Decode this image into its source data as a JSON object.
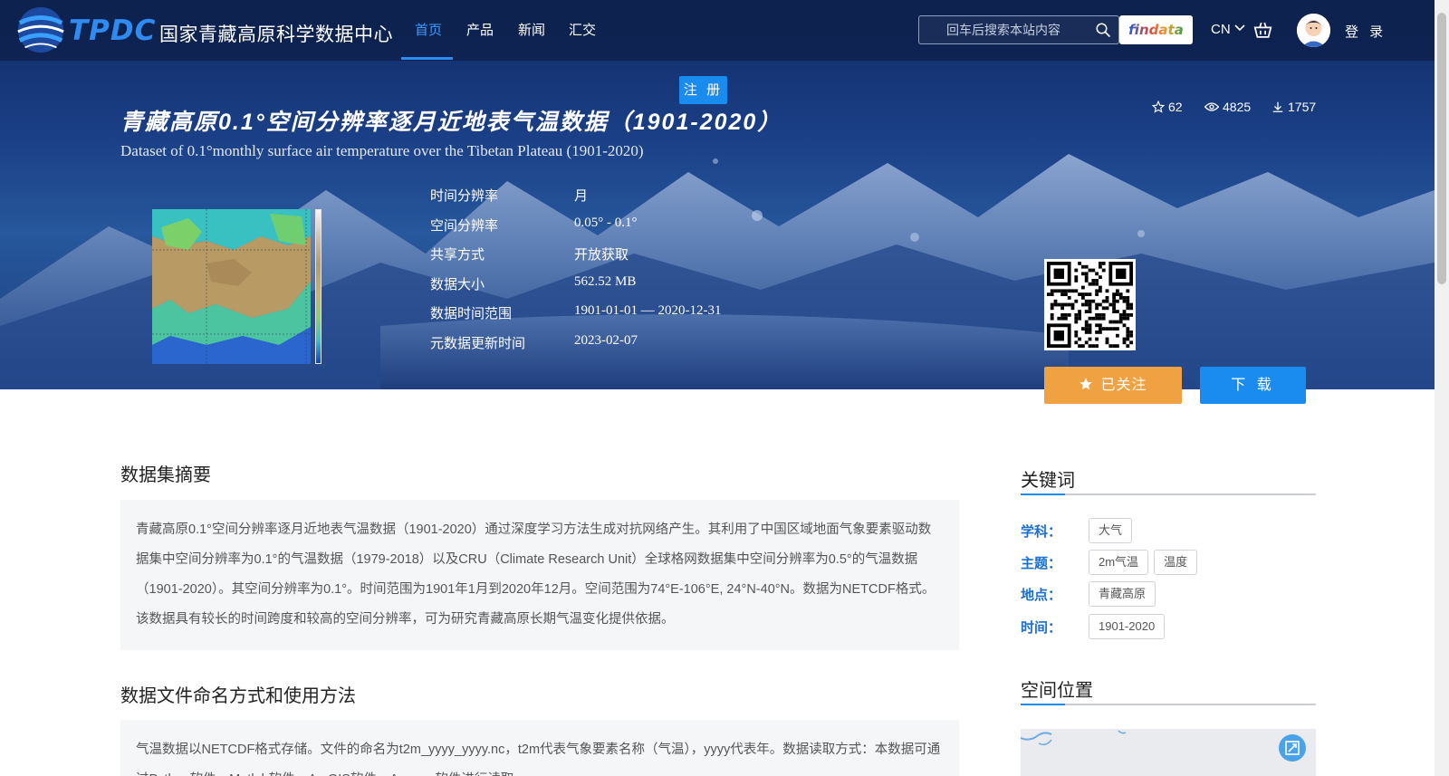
{
  "brand": {
    "logo_text": "TPDC",
    "name": "国家青藏高原科学数据中心"
  },
  "nav": {
    "items": [
      {
        "label": "首页",
        "active": true
      },
      {
        "label": "产品",
        "active": false
      },
      {
        "label": "新闻",
        "active": false
      },
      {
        "label": "汇交",
        "active": false
      }
    ]
  },
  "search": {
    "placeholder": "回车后搜索本站内容",
    "icon": "search-icon"
  },
  "findata_label": "findata",
  "lang_label": "CN",
  "login_label": "登 录",
  "register_label": "注 册",
  "dataset": {
    "title_cn": "青藏高原0.1°空间分辨率逐月近地表气温数据（1901-2020）",
    "title_en": "Dataset of 0.1°monthly surface air temperature over the Tibetan Plateau (1901-2020)",
    "stats": {
      "stars": "62",
      "views": "4825",
      "downloads": "1757"
    },
    "meta": [
      {
        "key": "时间分辨率",
        "value": "月"
      },
      {
        "key": "空间分辨率",
        "value": "0.05° - 0.1°"
      },
      {
        "key": "共享方式",
        "value": "开放获取"
      },
      {
        "key": "数据大小",
        "value": "562.52 MB"
      },
      {
        "key": "数据时间范围",
        "value": "1901-01-01 — 2020-12-31"
      },
      {
        "key": "元数据更新时间",
        "value": "2023-02-07"
      }
    ],
    "follow_label": "已关注",
    "download_label": "下 载"
  },
  "abstract": {
    "title": "数据集摘要",
    "text": "青藏高原0.1°空间分辨率逐月近地表气温数据（1901-2020）通过深度学习方法生成对抗网络产生。其利用了中国区域地面气象要素驱动数据集中空间分辨率为0.1°的气温数据（1979-2018）以及CRU（Climate Research Unit）全球格网数据集中空间分辨率为0.5°的气温数据（1901-2020）。其空间分辨率为0.1°。时间范围为1901年1月到2020年12月。空间范围为74°E-106°E, 24°N-40°N。数据为NETCDF格式。该数据具有较长的时间跨度和较高的空间分辨率，可为研究青藏高原长期气温变化提供依据。"
  },
  "usage": {
    "title": "数据文件命名方式和使用方法",
    "text": "气温数据以NETCDF格式存储。文件的命名为t2m_yyyy_yyyy.nc，t2m代表气象要素名称（气温），yyyy代表年。数据读取方式：本数据可通过Python软件、Matlab软件、ArcGIS软件、Arcmap软件进行读取。"
  },
  "keywords": {
    "title": "关键词",
    "rows": [
      {
        "label": "学科：",
        "tags": [
          "大气"
        ]
      },
      {
        "label": "主题：",
        "tags": [
          "2m气温",
          "温度"
        ]
      },
      {
        "label": "地点：",
        "tags": [
          "青藏高原"
        ]
      },
      {
        "label": "时间：",
        "tags": [
          "1901-2020"
        ]
      }
    ]
  },
  "location": {
    "title": "空间位置"
  },
  "colors": {
    "header_bg": "#0e224e",
    "accent_blue": "#1a8cf0",
    "follow_orange": "#f0a243",
    "keyword_label": "#1a6fd0"
  }
}
